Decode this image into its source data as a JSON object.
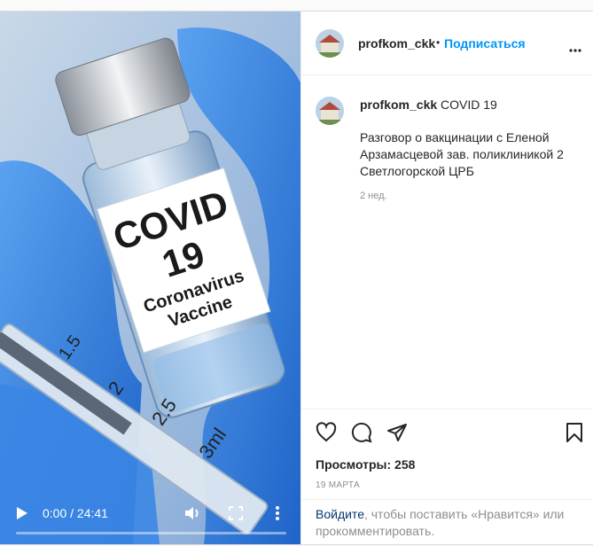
{
  "post": {
    "username": "profkom_ckk",
    "follow_label": "Подписаться",
    "separator": "•",
    "more_icon": "more-dots-icon",
    "caption_title": "COVID 19",
    "caption_body": "Разговор о вакцинации с Еленой Арзамасцевой зав. поликлиникой 2 Светлогорской ЦРБ",
    "age": "2 нед.",
    "views_label": "Просмотры: 258",
    "date": "19 МАРТА",
    "login_link": "Войдите",
    "login_text": ", чтобы поставить «Нравится» или прокомментировать."
  },
  "video": {
    "label_line1": "COVID",
    "label_line2": "19",
    "label_line3": "Coronavirus",
    "label_line4": "Vaccine",
    "syringe_marks": [
      "1.5",
      "2",
      "2.5",
      "3ml"
    ],
    "time": "0:00 / 24:41",
    "progress_fraction": 0.0,
    "icons": [
      "play-icon",
      "volume-icon",
      "fullscreen-icon",
      "more-vertical-icon"
    ]
  },
  "actions": {
    "icons": [
      "heart-icon",
      "comment-icon",
      "share-icon",
      "bookmark-icon"
    ]
  },
  "colors": {
    "link": "#0095f6",
    "text": "#262626",
    "muted": "#8e8e8e",
    "glove": "#2f7fe0"
  }
}
